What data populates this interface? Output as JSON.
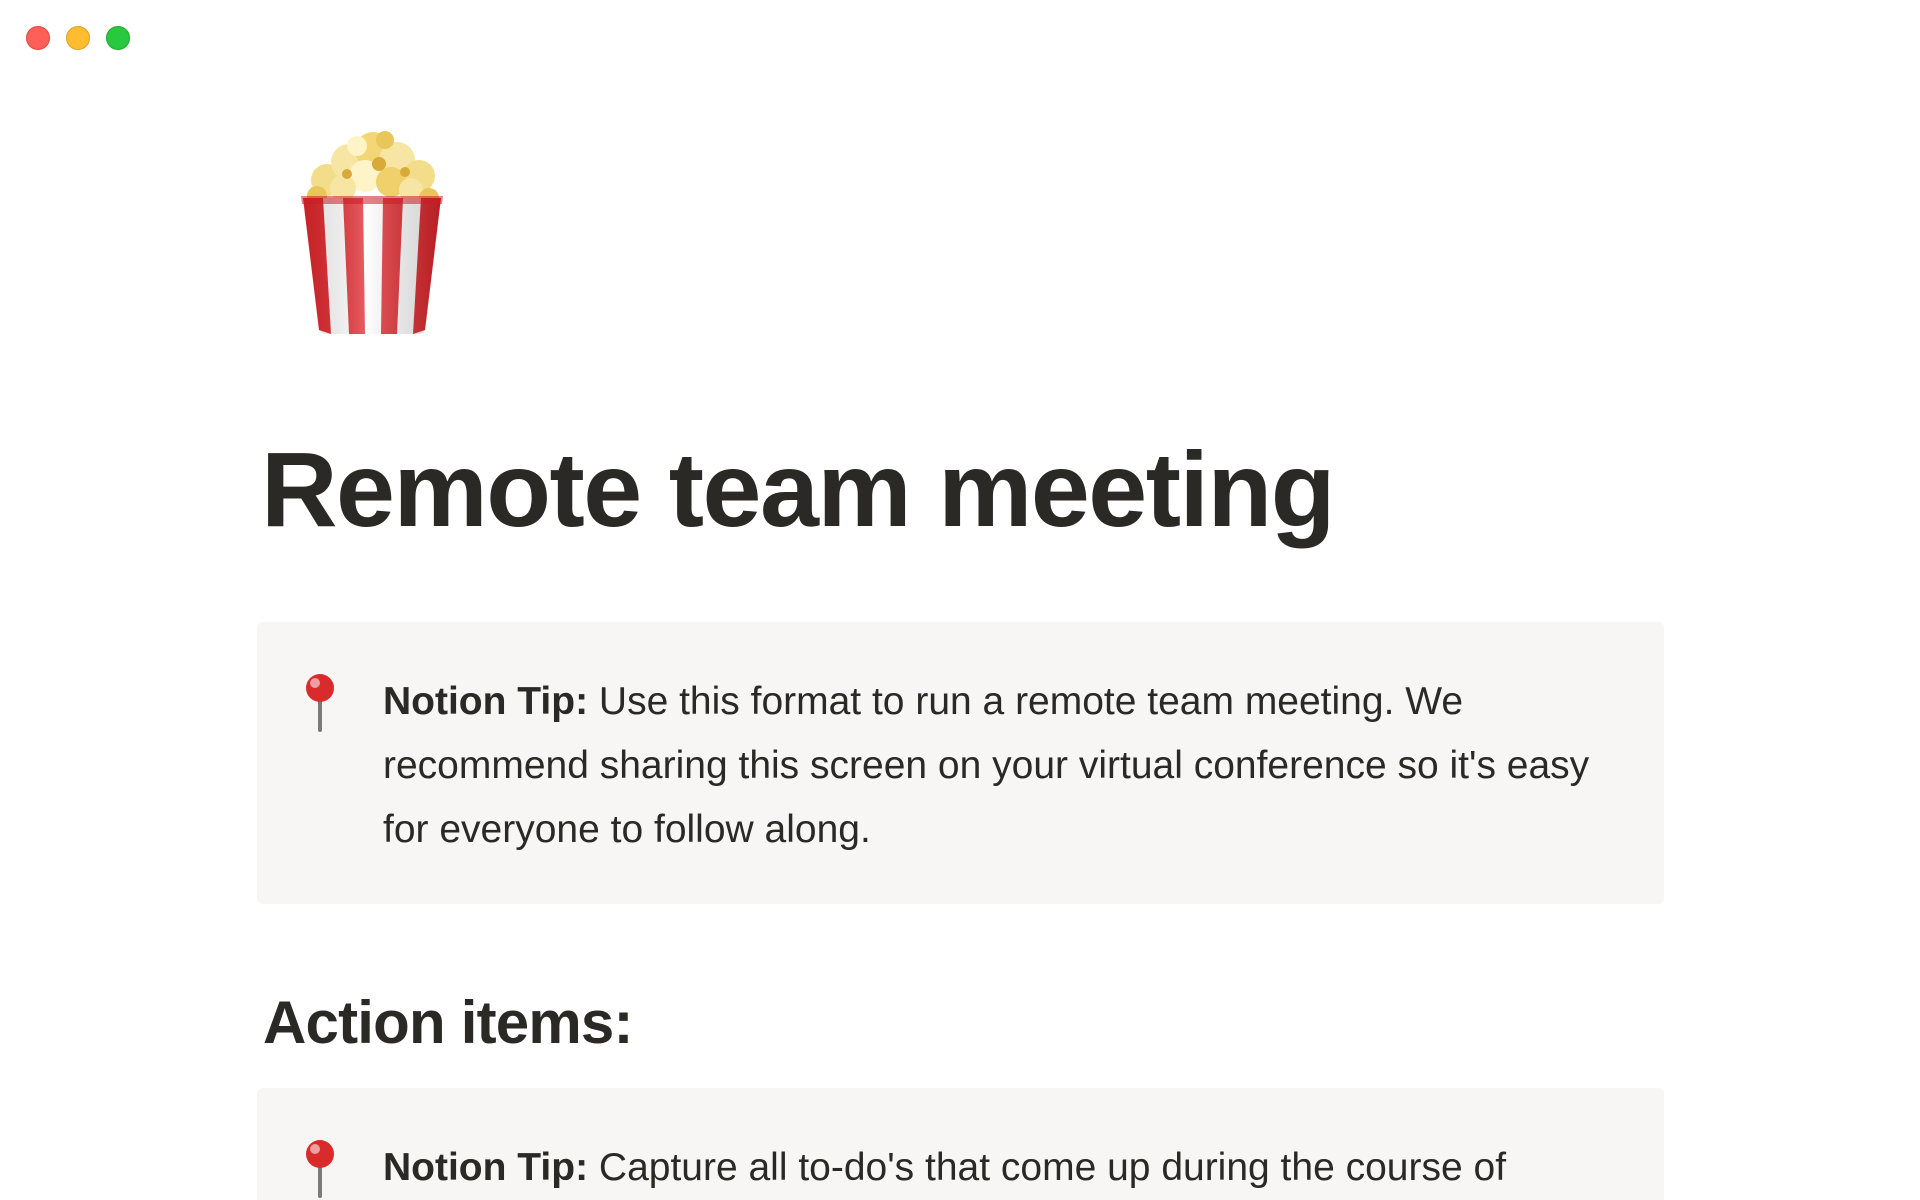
{
  "window": {
    "controls": [
      "close",
      "minimize",
      "maximize"
    ]
  },
  "page": {
    "icon": "popcorn-icon",
    "title": "Remote team meeting"
  },
  "callouts": [
    {
      "icon": "round-pushpin-icon",
      "label": "Notion Tip:",
      "text": " Use this format to run a remote team meeting. We recommend sharing this screen on your virtual conference so it's easy for everyone to follow along."
    },
    {
      "icon": "round-pushpin-icon",
      "label": "Notion Tip:",
      "text": " Capture all to-do's that come up during the course of"
    }
  ],
  "sections": {
    "action_items_heading": "Action items:"
  },
  "colors": {
    "close": "#fe5f57",
    "minimize": "#febc2e",
    "maximize": "#28c840",
    "callout_bg": "#f7f6f5",
    "text": "#2a2925"
  }
}
